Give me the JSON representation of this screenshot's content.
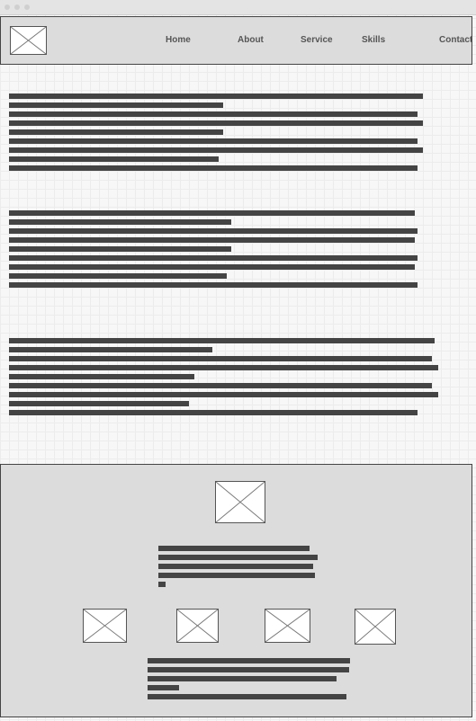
{
  "header": {
    "logo_icon": "placeholder-image-icon",
    "nav_items": [
      {
        "label": "Home"
      },
      {
        "label": "About"
      },
      {
        "label": "Service"
      },
      {
        "label": "Skills"
      },
      {
        "label": "Contact"
      }
    ]
  },
  "colors": {
    "background": "#f7f7f7",
    "panel": "#dcdcdc",
    "text_bar": "#444444",
    "border": "#444444"
  },
  "main": {
    "paragraph_count": 3
  },
  "footer": {
    "hero_icon": "placeholder-image-icon",
    "thumbnail_count": 4,
    "thumbnail_icon": "placeholder-image-icon"
  }
}
